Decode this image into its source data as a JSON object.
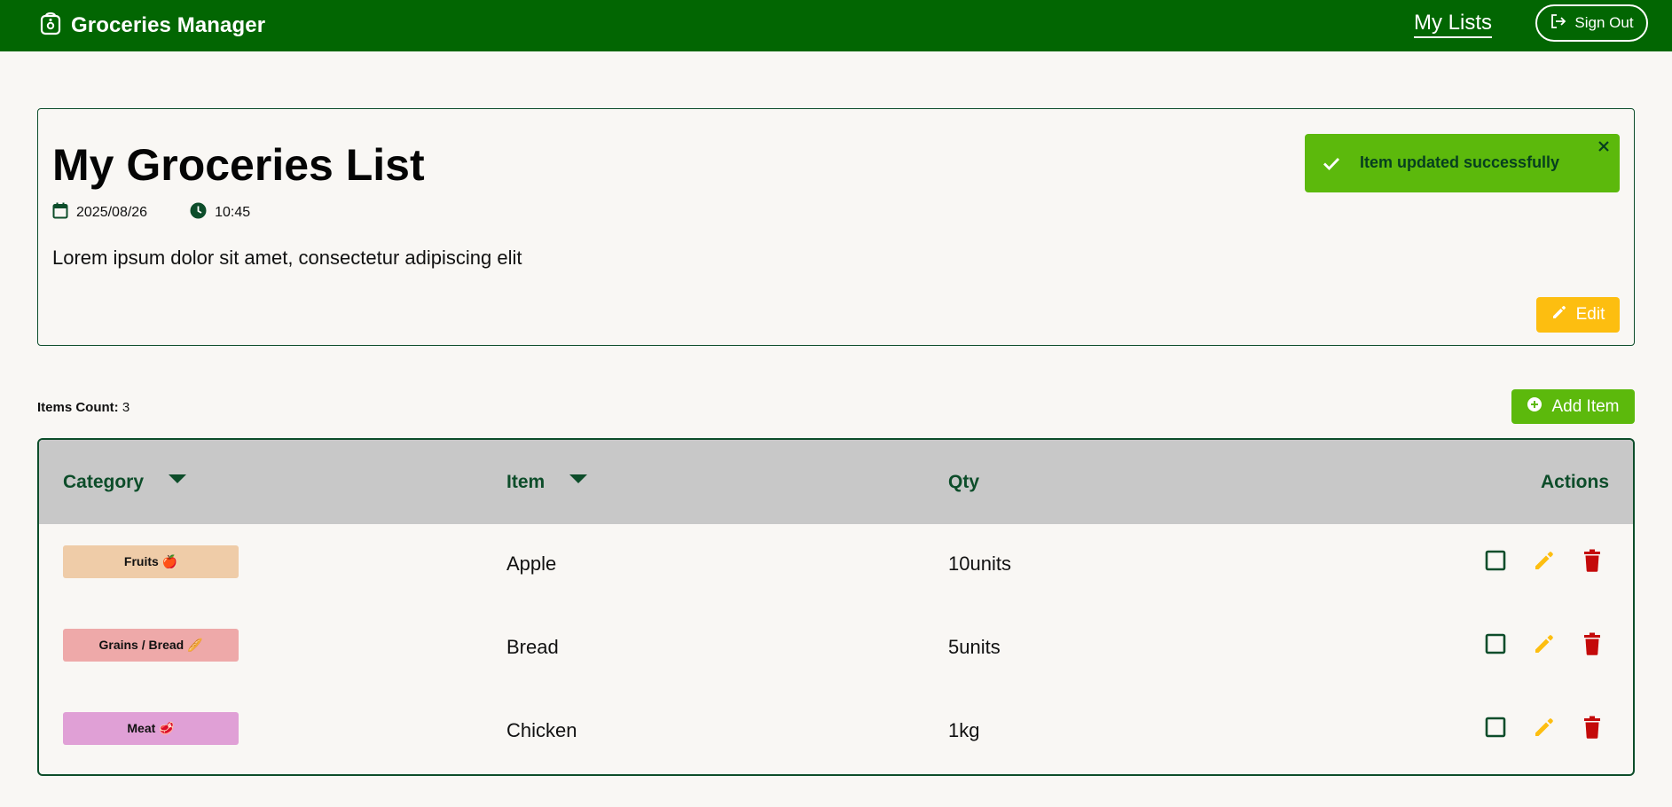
{
  "header": {
    "brand": "Groceries Manager",
    "nav_link": "My Lists",
    "sign_out": "Sign Out",
    "colors": {
      "bar": "#026602"
    }
  },
  "list": {
    "title": "My Groceries List",
    "date": "2025/08/26",
    "time": "10:45",
    "description": "Lorem ipsum dolor sit amet, consectetur adipiscing elit",
    "edit_label": "Edit"
  },
  "toast": {
    "message": "Item updated successfully",
    "icon": "check-icon"
  },
  "summary": {
    "items_count_label": "Items Count:",
    "items_count_value": " 3",
    "add_item_label": "Add Item"
  },
  "table": {
    "columns": [
      "Category",
      "Item",
      "Qty",
      "Actions"
    ],
    "rows": [
      {
        "category": "Fruits 🍎",
        "category_color": "#efcca8",
        "item": "Apple",
        "qty": "10units"
      },
      {
        "category": "Grains / Bread 🥖",
        "category_color": "#eea9a9",
        "item": "Bread",
        "qty": "5units"
      },
      {
        "category": "Meat 🥩",
        "category_color": "#e0a0d6",
        "item": "Chicken",
        "qty": "1kg"
      }
    ],
    "row_actions": [
      "checkbox-icon",
      "pencil-icon",
      "trash-icon"
    ],
    "colors": {
      "edit": "#fdbe10",
      "delete": "#c40a0a",
      "check": "#0d4d2a"
    }
  }
}
